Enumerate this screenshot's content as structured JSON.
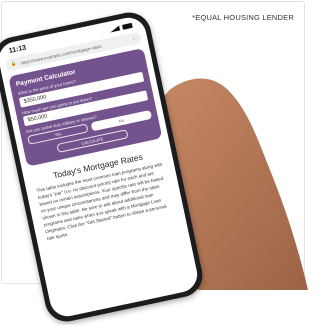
{
  "disclaimer": "*EQUAL HOUSING LENDER",
  "status": {
    "time": "11:13"
  },
  "browser": {
    "url": "https://www.example.com/mortgage-rates"
  },
  "calculator": {
    "title": "Payment Calculator",
    "home_price_label": "What is the price of your home?",
    "home_price_value": "$350,000",
    "down_payment_label": "How much are you going to put down?",
    "down_payment_value": "$50,000",
    "veteran_label": "Are you active duty military or veteran?",
    "yes_label": "Yes",
    "no_label": "No",
    "calculate_label": "CALCULATE"
  },
  "rates": {
    "heading": "Today's Mortgage Rates",
    "body": "This table includes the most common loan programs along with today's \"par\" (i.e. no discount points) rate for each and are based on certain assumptions. Your specific rate will be based on your unique circumstances and may differ from the rates shown in this table. Be sure to ask about additional loan programs and rates when you speak with a Mortgage Loan Originator. Click the \"Get Started\" button to obtain a personal rate quote."
  },
  "colors": {
    "accent": "#74528d"
  }
}
